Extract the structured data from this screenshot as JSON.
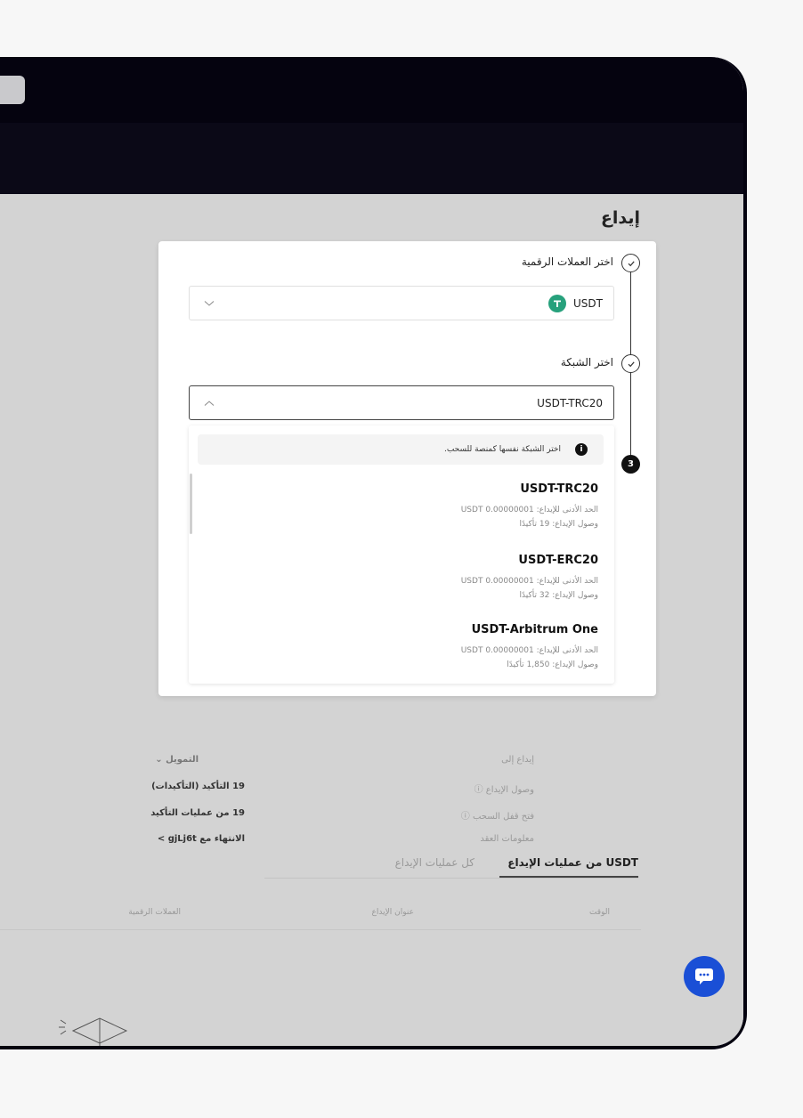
{
  "page": {
    "title": "إيداع"
  },
  "steps": {
    "step1_label": "اختر العملات الرقمية",
    "step2_label": "اختر الشبكة",
    "step3_number": "3"
  },
  "coin_select": {
    "value": "USDT",
    "icon": "tether-icon"
  },
  "network_select": {
    "value": "USDT-TRC20"
  },
  "notice": {
    "icon_text": "i",
    "text": "اختر الشبكة نفسها كمنصة للسحب."
  },
  "networks": [
    {
      "name": "USDT-TRC20",
      "min_deposit": "الحد الأدنى للإيداع: 0.00000001 USDT",
      "arrival": "وصول الإيداع: 19 تأكيدًا"
    },
    {
      "name": "USDT-ERC20",
      "min_deposit": "الحد الأدنى للإيداع: 0.00000001 USDT",
      "arrival": "وصول الإيداع: 32 تأكيدًا"
    },
    {
      "name": "USDT-Arbitrum One",
      "min_deposit": "الحد الأدنى للإيداع: 0.00000001 USDT",
      "arrival": "وصول الإيداع: 1,850 تأكيدًا"
    }
  ],
  "background_info": {
    "rows": [
      {
        "label": "إيداع إلى",
        "value": "التمويل ⌄"
      },
      {
        "label": "وصول الإيداع ⓘ",
        "value": "19 التأكيد (التأكيدات)"
      },
      {
        "label": "فتح قفل السحب ⓘ",
        "value": "19 من عمليات التأكيد"
      },
      {
        "label": "معلومات العقد",
        "value": "الانتهاء مع gjLj6t  >"
      }
    ]
  },
  "history_tabs": {
    "active": "USDT من عمليات الإيداع",
    "inactive": "كل عمليات الإيداع"
  },
  "table_headers": [
    "الوقت",
    "عنوان الإيداع",
    "العملات الرقمية"
  ],
  "colors": {
    "accent_blue": "#1a4fd6",
    "tether_green": "#27a17c",
    "dark_bar": "#05030f"
  }
}
